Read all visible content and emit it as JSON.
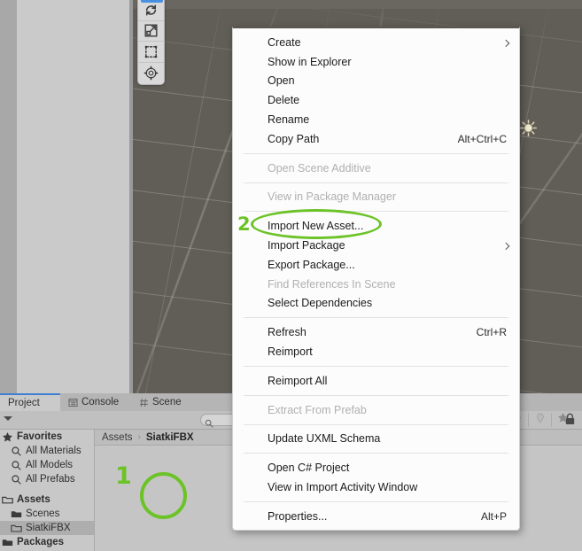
{
  "scene": {
    "tools": [
      {
        "name": "rotate-tool",
        "icon": "rotate-icon"
      },
      {
        "name": "scale-tool",
        "icon": "scale-icon"
      },
      {
        "name": "rect-tool",
        "icon": "rect-transform-icon"
      },
      {
        "name": "transform-tool",
        "icon": "move-rotate-scale-icon"
      }
    ],
    "gizmo": "directional-light-gizmo"
  },
  "context_menu": {
    "items": [
      {
        "label": "Create",
        "shortcut": "",
        "disabled": false,
        "submenu": true,
        "sep_after": false
      },
      {
        "label": "Show in Explorer",
        "shortcut": "",
        "disabled": false,
        "submenu": false,
        "sep_after": false
      },
      {
        "label": "Open",
        "shortcut": "",
        "disabled": false,
        "submenu": false,
        "sep_after": false
      },
      {
        "label": "Delete",
        "shortcut": "",
        "disabled": false,
        "submenu": false,
        "sep_after": false
      },
      {
        "label": "Rename",
        "shortcut": "",
        "disabled": false,
        "submenu": false,
        "sep_after": false
      },
      {
        "label": "Copy Path",
        "shortcut": "Alt+Ctrl+C",
        "disabled": false,
        "submenu": false,
        "sep_after": true
      },
      {
        "label": "Open Scene Additive",
        "shortcut": "",
        "disabled": true,
        "submenu": false,
        "sep_after": true
      },
      {
        "label": "View in Package Manager",
        "shortcut": "",
        "disabled": true,
        "submenu": false,
        "sep_after": true
      },
      {
        "label": "Import New Asset...",
        "shortcut": "",
        "disabled": false,
        "submenu": false,
        "sep_after": false
      },
      {
        "label": "Import Package",
        "shortcut": "",
        "disabled": false,
        "submenu": true,
        "sep_after": false
      },
      {
        "label": "Export Package...",
        "shortcut": "",
        "disabled": false,
        "submenu": false,
        "sep_after": false
      },
      {
        "label": "Find References In Scene",
        "shortcut": "",
        "disabled": true,
        "submenu": false,
        "sep_after": false
      },
      {
        "label": "Select Dependencies",
        "shortcut": "",
        "disabled": false,
        "submenu": false,
        "sep_after": true
      },
      {
        "label": "Refresh",
        "shortcut": "Ctrl+R",
        "disabled": false,
        "submenu": false,
        "sep_after": false
      },
      {
        "label": "Reimport",
        "shortcut": "",
        "disabled": false,
        "submenu": false,
        "sep_after": true
      },
      {
        "label": "Reimport All",
        "shortcut": "",
        "disabled": false,
        "submenu": false,
        "sep_after": true
      },
      {
        "label": "Extract From Prefab",
        "shortcut": "",
        "disabled": true,
        "submenu": false,
        "sep_after": true
      },
      {
        "label": "Update UXML Schema",
        "shortcut": "",
        "disabled": false,
        "submenu": false,
        "sep_after": true
      },
      {
        "label": "Open C# Project",
        "shortcut": "",
        "disabled": false,
        "submenu": false,
        "sep_after": false
      },
      {
        "label": "View in Import Activity Window",
        "shortcut": "",
        "disabled": false,
        "submenu": false,
        "sep_after": true
      },
      {
        "label": "Properties...",
        "shortcut": "Alt+P",
        "disabled": false,
        "submenu": false,
        "sep_after": false
      }
    ]
  },
  "project_window": {
    "tabs": [
      {
        "label": "Project",
        "icon": "",
        "active": true
      },
      {
        "label": "Console",
        "icon": "console-icon",
        "active": false
      },
      {
        "label": "Scene",
        "icon": "grid-icon",
        "active": false
      }
    ],
    "search": {
      "placeholder": "",
      "value": "",
      "icon": "search-icon"
    },
    "toolbar_buttons": [
      {
        "name": "filter-by-type-button",
        "icon": "tag-icon"
      },
      {
        "name": "filter-by-label-button",
        "icon": "label-icon"
      },
      {
        "name": "favorite-button",
        "icon": "star-icon"
      }
    ],
    "lock_icon": "lock-icon",
    "tree": [
      {
        "label": "Favorites",
        "icon": "star-icon",
        "bold": true,
        "indent": false,
        "selected": false
      },
      {
        "label": "All Materials",
        "icon": "search-icon",
        "bold": false,
        "indent": true,
        "selected": false
      },
      {
        "label": "All Models",
        "icon": "search-icon",
        "bold": false,
        "indent": true,
        "selected": false
      },
      {
        "label": "All Prefabs",
        "icon": "search-icon",
        "bold": false,
        "indent": true,
        "selected": false
      },
      {
        "label": "Assets",
        "icon": "folder-open-icon",
        "bold": true,
        "indent": false,
        "selected": false,
        "gap_before": true
      },
      {
        "label": "Scenes",
        "icon": "folder-icon",
        "bold": false,
        "indent": true,
        "selected": false
      },
      {
        "label": "SiatkiFBX",
        "icon": "folder-outline-icon",
        "bold": false,
        "indent": true,
        "selected": true
      },
      {
        "label": "Packages",
        "icon": "folder-icon",
        "bold": true,
        "indent": false,
        "selected": false
      }
    ],
    "breadcrumb": {
      "root": "Assets",
      "separator": "›",
      "current": "SiatkiFBX"
    }
  },
  "annotations": [
    {
      "name": "annotation-marker-1",
      "label": "1",
      "color": "#6cc328"
    },
    {
      "name": "annotation-marker-2",
      "label": "2",
      "color": "#6cc328"
    }
  ]
}
